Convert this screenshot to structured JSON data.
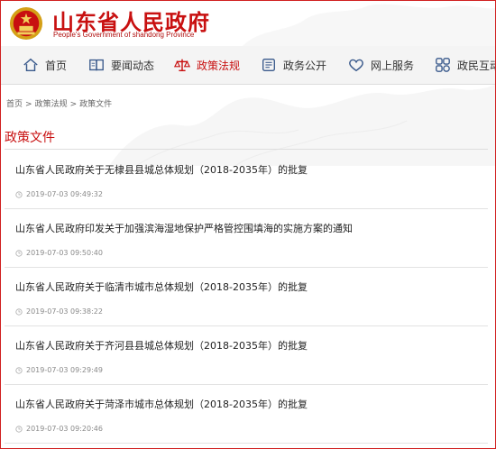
{
  "header": {
    "title": "山东省人民政府",
    "subtitle": "People's Government of shandong Province"
  },
  "nav": {
    "items": [
      {
        "label": "首页",
        "icon": "home-icon"
      },
      {
        "label": "要闻动态",
        "icon": "book-icon"
      },
      {
        "label": "政策法规",
        "icon": "scales-icon",
        "active": true
      },
      {
        "label": "政务公开",
        "icon": "document-icon"
      },
      {
        "label": "网上服务",
        "icon": "heart-icon"
      },
      {
        "label": "政民互动",
        "icon": "interaction-icon"
      }
    ],
    "active_color": "#c81010"
  },
  "breadcrumb": {
    "home": "首页",
    "sep1": ">",
    "section": "政策法规",
    "sep2": ">",
    "current": "政策文件"
  },
  "page_title": "政策文件",
  "articles": [
    {
      "title": "山东省人民政府关于无棣县县城总体规划（2018-2035年）的批复",
      "datetime": "2019-07-03 09:49:32"
    },
    {
      "title": "山东省人民政府印发关于加强滨海湿地保护严格管控围填海的实施方案的通知",
      "datetime": "2019-07-03 09:50:40"
    },
    {
      "title": "山东省人民政府关于临清市城市总体规划（2018-2035年）的批复",
      "datetime": "2019-07-03 09:38:22"
    },
    {
      "title": "山东省人民政府关于齐河县县城总体规划（2018-2035年）的批复",
      "datetime": "2019-07-03 09:29:49"
    },
    {
      "title": "山东省人民政府关于菏泽市城市总体规划（2018-2035年）的批复",
      "datetime": "2019-07-03 09:20:46"
    }
  ]
}
